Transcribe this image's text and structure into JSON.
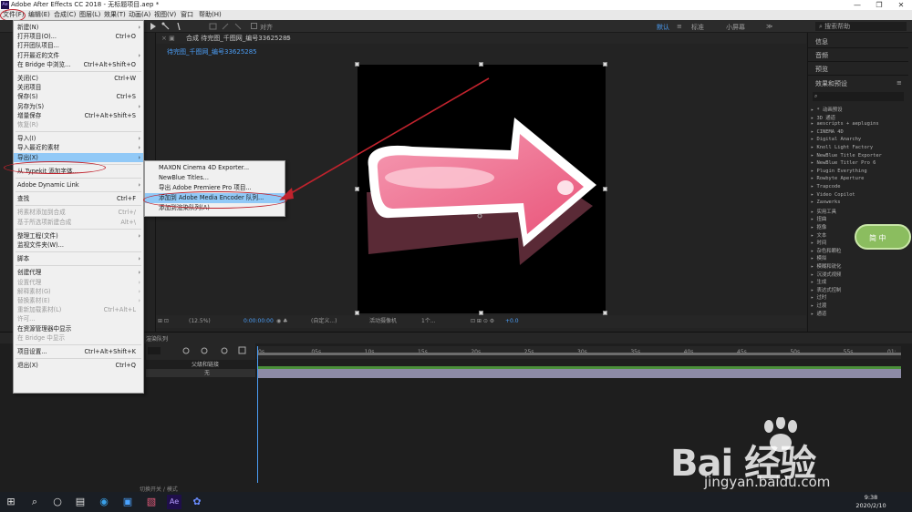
{
  "window": {
    "app_icon": "Ae",
    "title": "Adobe After Effects CC 2018 - 无标题项目.aep *",
    "buttons": [
      "—",
      "❐",
      "✕"
    ]
  },
  "menubar": {
    "items": [
      "文件(F)",
      "编辑(E)",
      "合成(C)",
      "图层(L)",
      "效果(T)",
      "动画(A)",
      "视图(V)",
      "窗口",
      "帮助(H)"
    ]
  },
  "toolbar": {
    "align_label": "对齐",
    "workspaces": [
      "默认",
      "≡",
      "标准",
      "小屏幕",
      "≫"
    ],
    "search_placeholder": "搜索帮助"
  },
  "comp_panel": {
    "tab_label": "合成 待完图_千图网_编号33625285",
    "sub_tab": "待完图_千图网_编号33625285",
    "zoom": "(12.5%)",
    "timecode": "0:00:00:00",
    "resolution": "(自定义...)",
    "camera": "活动摄像机",
    "views": "1个...",
    "exposure": "+0.0"
  },
  "right_panel": {
    "sections": [
      "信息",
      "音频",
      "预览",
      "效果和预设"
    ],
    "effects": [
      "▸ * 动画预设",
      "▸ 3D 通道",
      "▸ aescripts + aeplugins",
      "▸ CINEMA 4D",
      "▸ Digital Anarchy",
      "▸ Knoll Light Factory",
      "▸ NewBlue Title Exporter",
      "▸ NewBlue Titler Pro 6",
      "▸ Plugin Everything",
      "▸ Rowbyte Aperture",
      "▸ Trapcode",
      "▸ Video Copilot",
      "▸ Zaxwerks",
      "▸ 实用工具",
      "▸ 扭曲",
      "▸ 抠像",
      "▸ 文本",
      "▸ 时间",
      "▸ 杂色和颗粒",
      "▸ 模拟",
      "▸ 模糊和锐化",
      "▸ 沉浸式视频",
      "▸ 生成",
      "▸ 表达式控制",
      "▸ 过时",
      "▸ 过渡",
      "▸ 通道"
    ]
  },
  "timeline": {
    "tab": "渲染队列",
    "layer_header": "父级和链接",
    "layer_parent": "无",
    "ruler": [
      "0s",
      "05s",
      "10s",
      "15s",
      "20s",
      "25s",
      "30s",
      "35s",
      "40s",
      "45s",
      "50s",
      "55s",
      "01:"
    ],
    "footer_toggle": "切换开关 / 模式"
  },
  "file_menu": {
    "items": [
      {
        "label": "新建(N)",
        "arrow": true
      },
      {
        "label": "打开项目(O)...",
        "shortcut": "Ctrl+O"
      },
      {
        "label": "打开团队项目..."
      },
      {
        "label": "打开最近的文件",
        "arrow": true
      },
      {
        "label": "在 Bridge 中浏览...",
        "shortcut": "Ctrl+Alt+Shift+O"
      },
      {
        "sep": true
      },
      {
        "label": "关闭(C)",
        "shortcut": "Ctrl+W"
      },
      {
        "label": "关闭项目"
      },
      {
        "label": "保存(S)",
        "shortcut": "Ctrl+S"
      },
      {
        "label": "另存为(S)",
        "arrow": true
      },
      {
        "label": "增量保存",
        "shortcut": "Ctrl+Alt+Shift+S"
      },
      {
        "label": "恢复(R)",
        "disabled": true
      },
      {
        "sep": true
      },
      {
        "label": "导入(I)",
        "arrow": true
      },
      {
        "label": "导入最近的素材",
        "arrow": true
      },
      {
        "label": "导出(X)",
        "arrow": true,
        "highlight": true
      },
      {
        "sep": true
      },
      {
        "label": "从 Typekit 添加字体..."
      },
      {
        "sep": true
      },
      {
        "label": "Adobe Dynamic Link",
        "arrow": true
      },
      {
        "sep": true
      },
      {
        "label": "查找",
        "shortcut": "Ctrl+F"
      },
      {
        "sep": true
      },
      {
        "label": "将素材添加到合成",
        "shortcut": "Ctrl+/",
        "disabled": true
      },
      {
        "label": "基于所选项新建合成",
        "shortcut": "Alt+\\",
        "disabled": true
      },
      {
        "sep": true
      },
      {
        "label": "整理工程(文件)",
        "arrow": true
      },
      {
        "label": "监视文件夹(W)..."
      },
      {
        "sep": true
      },
      {
        "label": "脚本",
        "arrow": true
      },
      {
        "sep": true
      },
      {
        "label": "创建代理",
        "arrow": true
      },
      {
        "label": "设置代理",
        "arrow": true,
        "disabled": true
      },
      {
        "label": "解释素材(G)",
        "arrow": true,
        "disabled": true
      },
      {
        "label": "替换素材(E)",
        "arrow": true,
        "disabled": true
      },
      {
        "label": "重新加载素材(L)",
        "shortcut": "Ctrl+Alt+L",
        "disabled": true
      },
      {
        "label": "许可...",
        "disabled": true
      },
      {
        "label": "在资源管理器中显示"
      },
      {
        "label": "在 Bridge 中显示",
        "disabled": true
      },
      {
        "sep": true
      },
      {
        "label": "项目设置...",
        "shortcut": "Ctrl+Alt+Shift+K"
      },
      {
        "sep": true
      },
      {
        "label": "退出(X)",
        "shortcut": "Ctrl+Q"
      }
    ]
  },
  "export_submenu": {
    "items": [
      {
        "label": "MAXON Cinema 4D Exporter..."
      },
      {
        "label": "NewBlue Titles..."
      },
      {
        "label": "导出 Adobe Premiere Pro 项目..."
      },
      {
        "label": "添加到 Adobe Media Encoder 队列...",
        "highlight": true
      },
      {
        "label": "添加到渲染队列(A)"
      }
    ]
  },
  "widget": {
    "text": "简 中"
  },
  "watermark": {
    "logo": "Bai 经验",
    "url": "jingyan.baidu.com"
  },
  "taskbar": {
    "time": "9:38",
    "date": "2020/2/10"
  },
  "colors": {
    "arrow_pink": "#f07a95",
    "highlight": "#91c9f7",
    "annotation_red": "#c0232d",
    "accent_blue": "#4b9df5"
  }
}
